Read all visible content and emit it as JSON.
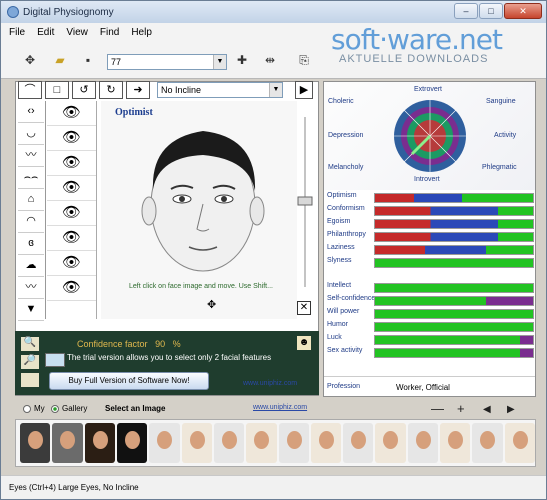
{
  "window": {
    "title": "Digital Physiognomy",
    "min": "–",
    "max": "□",
    "close": "✕"
  },
  "menu": [
    "File",
    "Edit",
    "View",
    "Find",
    "Help"
  ],
  "watermark": {
    "brand": "soft·ware.net",
    "sub": "AKTUELLE DOWNLOADS"
  },
  "toolbar": {
    "zoom_value": "77",
    "incline_value": "No Incline"
  },
  "left_panel": {
    "title": "Optimist",
    "hint": "Left click on face image and move. Use Shift...",
    "confidence_label": "Confidence factor",
    "confidence_value": "90",
    "confidence_unit": "%",
    "trial_text": "The trial version allows you to select only 2 facial features",
    "buy_button": "Buy Full Version of Software Now!",
    "site_link": "www.uniphiz.com"
  },
  "temperament": {
    "extrovert": "Extrovert",
    "introvert": "Introvert",
    "choleric": "Choleric",
    "sanguine": "Sanguine",
    "depression": "Depression",
    "activity": "Activity",
    "melancholy": "Melancholy",
    "phlegmatic": "Phlegmatic"
  },
  "traits_top": [
    {
      "label": "Optimism",
      "value": 0.55
    },
    {
      "label": "Conformism",
      "value": 0.78
    },
    {
      "label": "Egoism",
      "value": 0.78
    },
    {
      "label": "Philanthropy",
      "value": 0.78
    },
    {
      "label": "Laziness",
      "value": 0.7
    },
    {
      "label": "Slyness",
      "value": 0.0
    }
  ],
  "traits_bottom": [
    {
      "label": "Intellect",
      "value": 1.0
    },
    {
      "label": "Self-confidence",
      "value": 0.7
    },
    {
      "label": "Will power",
      "value": 1.0
    },
    {
      "label": "Humor",
      "value": 1.0
    },
    {
      "label": "Luck",
      "value": 0.92
    },
    {
      "label": "Sex activity",
      "value": 0.92
    }
  ],
  "profession": {
    "label": "Profession",
    "value": "Worker, Official"
  },
  "gallery": {
    "radio_my": "My",
    "radio_gallery": "Gallery",
    "select_label": "Select an Image",
    "link": "www.uniphiz.com",
    "minus": "—",
    "plus": "+",
    "prev": "◀",
    "next": "▶"
  },
  "status": "Eyes (Ctrl+4) Large Eyes, No Incline"
}
